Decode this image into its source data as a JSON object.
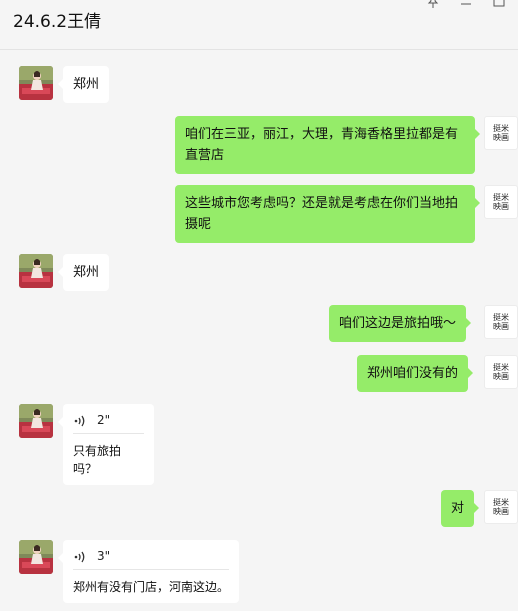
{
  "window": {
    "title": "24.6.2王倩",
    "controls": [
      "pin-icon",
      "minimize-icon",
      "maximize-icon"
    ]
  },
  "contact": {
    "avatar_icon": "contact-avatar-photo"
  },
  "self": {
    "avatar_line1": "挺米",
    "avatar_line2": "映画",
    "avatar_sub": "STUDIO"
  },
  "colors": {
    "sent_bubble": "#95ec69",
    "received_bubble": "#ffffff",
    "background": "#f5f5f5"
  },
  "messages": [
    {
      "from": "contact",
      "type": "text",
      "text": "郑州"
    },
    {
      "from": "self",
      "type": "text",
      "text": "咱们在三亚，丽江，大理，青海香格里拉都是有直营店"
    },
    {
      "from": "self",
      "type": "text",
      "text": "这些城市您考虑吗？还是就是考虑在你们当地拍摄呢"
    },
    {
      "from": "contact",
      "type": "text",
      "text": "郑州"
    },
    {
      "from": "self",
      "type": "text",
      "text": "咱们这边是旅拍哦～"
    },
    {
      "from": "self",
      "type": "text",
      "text": "郑州咱们没有的"
    },
    {
      "from": "contact",
      "type": "voice",
      "duration": "2\"",
      "transcript": "只有旅拍吗？"
    },
    {
      "from": "self",
      "type": "text",
      "text": "对"
    },
    {
      "from": "contact",
      "type": "voice",
      "duration": "3\"",
      "transcript": "郑州有没有门店，河南这边。"
    }
  ]
}
